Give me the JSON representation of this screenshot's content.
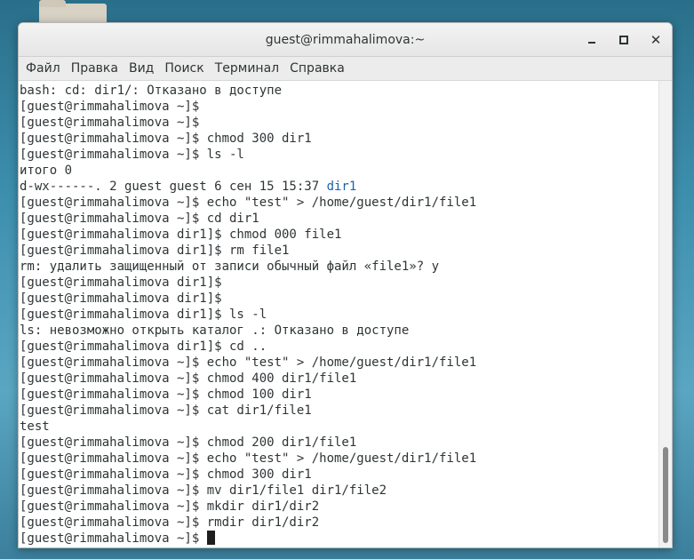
{
  "window": {
    "title": "guest@rimmahalimova:~"
  },
  "menu": [
    "Файл",
    "Правка",
    "Вид",
    "Поиск",
    "Терминал",
    "Справка"
  ],
  "terminal": {
    "lines": [
      "bash: cd: dir1/: Отказано в доступе",
      "[guest@rimmahalimova ~]$",
      "[guest@rimmahalimova ~]$",
      "[guest@rimmahalimova ~]$ chmod 300 dir1",
      "[guest@rimmahalimova ~]$ ls -l",
      "итого 0",
      "d-wx------. 2 guest guest 6 сен 15 15:37 ",
      "[guest@rimmahalimova ~]$ echo \"test\" > /home/guest/dir1/file1",
      "[guest@rimmahalimova ~]$ cd dir1",
      "[guest@rimmahalimova dir1]$ chmod 000 file1",
      "[guest@rimmahalimova dir1]$ rm file1",
      "rm: удалить защищенный от записи обычный файл «file1»? y",
      "[guest@rimmahalimova dir1]$",
      "[guest@rimmahalimova dir1]$",
      "[guest@rimmahalimova dir1]$ ls -l",
      "ls: невозможно открыть каталог .: Отказано в доступе",
      "[guest@rimmahalimova dir1]$ cd ..",
      "[guest@rimmahalimova ~]$ echo \"test\" > /home/guest/dir1/file1",
      "[guest@rimmahalimova ~]$ chmod 400 dir1/file1",
      "[guest@rimmahalimova ~]$ chmod 100 dir1",
      "[guest@rimmahalimova ~]$ cat dir1/file1",
      "test",
      "[guest@rimmahalimova ~]$ chmod 200 dir1/file1",
      "[guest@rimmahalimova ~]$ echo \"test\" > /home/guest/dir1/file1",
      "[guest@rimmahalimova ~]$ chmod 300 dir1",
      "[guest@rimmahalimova ~]$ mv dir1/file1 dir1/file2",
      "[guest@rimmahalimova ~]$ mkdir dir1/dir2",
      "[guest@rimmahalimova ~]$ rmdir dir1/dir2",
      "[guest@rimmahalimova ~]$ "
    ],
    "highlight_word": "dir1",
    "highlight_line_index": 6,
    "cursor_line_index": 28,
    "colors": {
      "text": "#2e3436",
      "highlight": "#1a5fb4",
      "background": "#ffffff"
    }
  },
  "icons": {
    "minimize": "minimize-icon",
    "maximize": "maximize-icon",
    "close": "close-icon"
  }
}
